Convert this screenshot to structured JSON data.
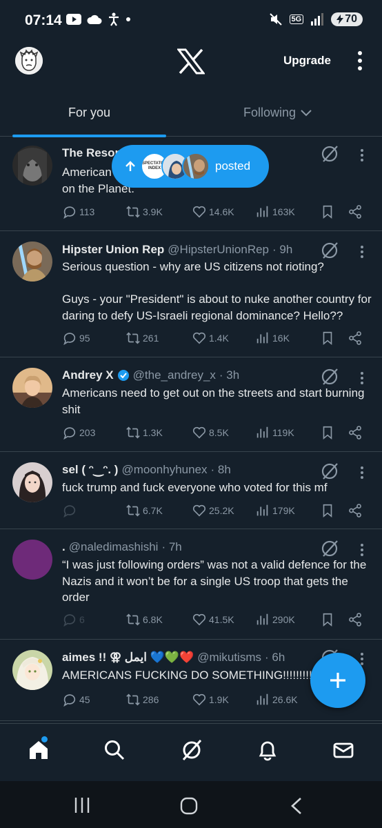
{
  "status": {
    "time": "07:14",
    "battery": "70",
    "network": "5G"
  },
  "topbar": {
    "upgrade_label": "Upgrade"
  },
  "tabs": [
    {
      "label": "For you"
    },
    {
      "label": "Following"
    }
  ],
  "posted_pill": {
    "label": "posted",
    "badge_text": "SPECTATOR INDEX"
  },
  "tweets": [
    {
      "name": "The Resor",
      "handle": "",
      "time": "",
      "text": "American                                                   rrorist organisation\non the Planet.",
      "replies": "113",
      "reposts": "3.9K",
      "likes": "14.6K",
      "views": "163K"
    },
    {
      "name": "Hipster Union Rep",
      "handle": "@HipsterUnionRep",
      "time": "· 9h",
      "text": "Serious question - why are US citizens not rioting?\n\nGuys - your \"President\" is about to nuke another country for daring to defy US-Israeli regional dominance? Hello??",
      "replies": "95",
      "reposts": "261",
      "likes": "1.4K",
      "views": "16K"
    },
    {
      "name": "Andrey X",
      "handle": "@the_andrey_x",
      "time": "· 3h",
      "text": "Americans need to get out on the streets and start burning shit",
      "replies": "203",
      "reposts": "1.3K",
      "likes": "8.5K",
      "views": "119K"
    },
    {
      "name": "sel ( ᵔ‿ᵔ. )",
      "handle": "@moonhyhunex",
      "time": "· 8h",
      "text": "fuck trump and fuck everyone who voted for this mf",
      "replies": "",
      "reposts": "6.7K",
      "likes": "25.2K",
      "views": "179K"
    },
    {
      "name": ".",
      "handle": "@naledimashishi",
      "time": "· 7h",
      "text": "“I was just following orders” was not a valid defence for the Nazis and it won’t be for a single US troop that gets the order",
      "replies": "6",
      "reposts": "6.8K",
      "likes": "41.5K",
      "views": "290K"
    },
    {
      "name": "aimes !! ⚢ ايمل 💙💚❤️",
      "handle": "@mikutisms",
      "time": "· 6h",
      "text": "AMERICANS FUCKING DO SOMETHING!!!!!!!!!!!!",
      "replies": "45",
      "reposts": "286",
      "likes": "1.9K",
      "views": "26.6K"
    }
  ],
  "colors": {
    "background": "#15202b",
    "accent": "#1d9bf0",
    "muted": "#8b98a5",
    "divider": "#38444d"
  }
}
